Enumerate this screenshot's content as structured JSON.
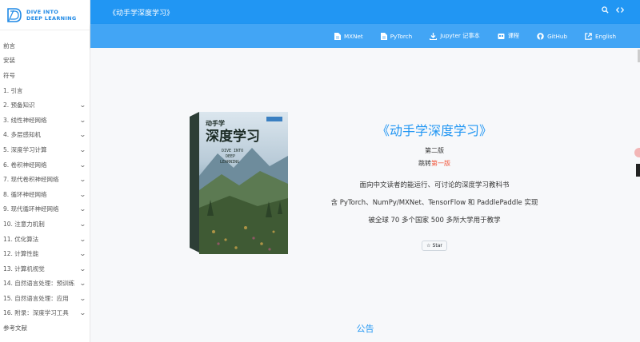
{
  "logo": {
    "line1": "DIVE INTO",
    "line2": "DEEP LEARNING"
  },
  "sidebar": {
    "items": [
      {
        "label": "前言",
        "expandable": false
      },
      {
        "label": "安装",
        "expandable": false
      },
      {
        "label": "符号",
        "expandable": false
      },
      {
        "label": "1. 引言",
        "expandable": false
      },
      {
        "label": "2. 预备知识",
        "expandable": true
      },
      {
        "label": "3. 线性神经网络",
        "expandable": true
      },
      {
        "label": "4. 多层感知机",
        "expandable": true
      },
      {
        "label": "5. 深度学习计算",
        "expandable": true
      },
      {
        "label": "6. 卷积神经网络",
        "expandable": true
      },
      {
        "label": "7. 现代卷积神经网络",
        "expandable": true
      },
      {
        "label": "8. 循环神经网络",
        "expandable": true
      },
      {
        "label": "9. 现代循环神经网络",
        "expandable": true
      },
      {
        "label": "10. 注意力机制",
        "expandable": true
      },
      {
        "label": "11. 优化算法",
        "expandable": true
      },
      {
        "label": "12. 计算性能",
        "expandable": true
      },
      {
        "label": "13. 计算机视觉",
        "expandable": true
      },
      {
        "label": "14. 自然语言处理：预训练",
        "expandable": true
      },
      {
        "label": "15. 自然语言处理：应用",
        "expandable": true
      },
      {
        "label": "16. 附录：深度学习工具",
        "expandable": true
      },
      {
        "label": "参考文献",
        "expandable": false
      }
    ]
  },
  "header": {
    "title": "《动手学深度学习》",
    "search_icon": "search-icon",
    "code_icon": "code-icon"
  },
  "subnav": {
    "links": [
      {
        "label": "MXNet",
        "icon": "file-icon"
      },
      {
        "label": "PyTorch",
        "icon": "file-icon"
      },
      {
        "label": "Jupyter 记事本",
        "icon": "download-icon"
      },
      {
        "label": "课程",
        "icon": "course-icon"
      },
      {
        "label": "GitHub",
        "icon": "github-icon"
      },
      {
        "label": "English",
        "icon": "external-link-icon"
      }
    ]
  },
  "hero": {
    "title": "《动手学深度学习》",
    "edition": "第二版",
    "switch_prefix": "跳转",
    "switch_link": "第一版",
    "line1": "面向中文读者的能运行、可讨论的深度学习教科书",
    "line2": "含 PyTorch、NumPy/MXNet、TensorFlow 和 PaddlePaddle 实现",
    "line3": "被全球 70 多个国家 500 多所大学用于教学",
    "star_label": "Star"
  },
  "book": {
    "cover_title": "深度学习",
    "cover_prefix": "动手学",
    "cover_en1": "DIVE INTO",
    "cover_en2": "DEEP",
    "cover_en3": "LEARNING"
  },
  "notice": {
    "heading": "公告"
  },
  "colors": {
    "primary": "#2196f3",
    "subnav": "#42a5f5",
    "accent": "#f0553a"
  }
}
